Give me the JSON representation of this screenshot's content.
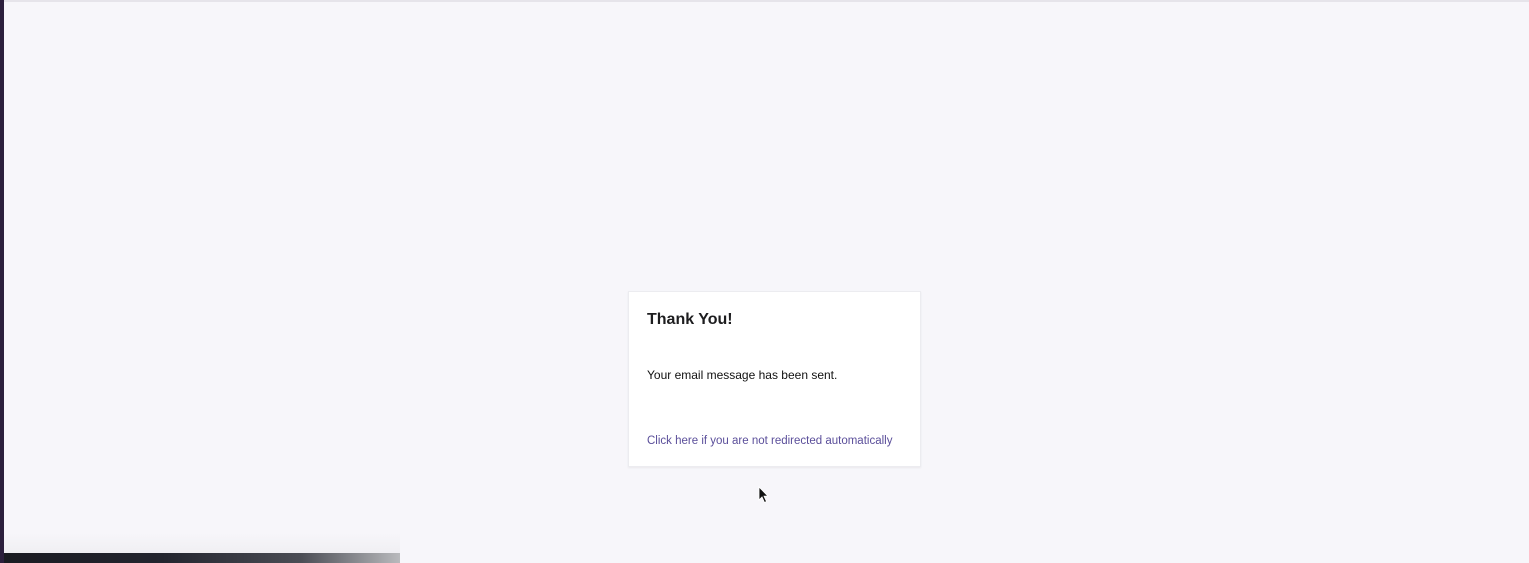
{
  "dialog": {
    "title": "Thank You!",
    "message": "Your email message has been sent.",
    "redirect_link": "Click here if you are not redirected automatically"
  },
  "colors": {
    "background": "#f7f6fa",
    "card": "#ffffff",
    "link": "#5a4e9a",
    "title": "#1d1d1f"
  },
  "icons": {
    "cursor": "mouse-pointer-icon"
  }
}
